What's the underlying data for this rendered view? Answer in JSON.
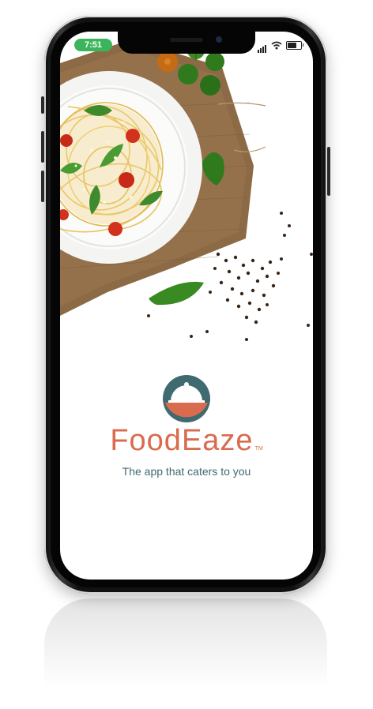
{
  "status_bar": {
    "time": "7:51",
    "signal_icon": "cellular-signal-icon",
    "wifi_icon": "wifi-icon",
    "battery_icon": "battery-icon"
  },
  "hero": {
    "image": "spaghetti-plate-photo",
    "elements": [
      "spaghetti-plate",
      "burlap-cloth",
      "cherry-tomatoes",
      "basil-leaf",
      "black-peppercorns"
    ]
  },
  "logo": {
    "icon": "serving-cloche-icon",
    "name": "FoodEaze",
    "tm": "TM",
    "tagline": "The app that caters to you"
  },
  "colors": {
    "brand_orange": "#d96b4e",
    "brand_teal": "#3f6a70",
    "status_green": "#3bb55b",
    "screen_bg": "#ffffff"
  }
}
